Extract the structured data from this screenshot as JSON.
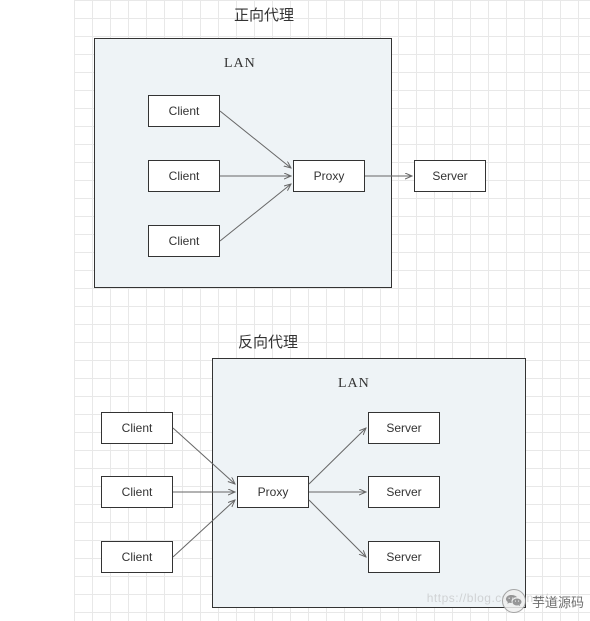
{
  "titles": {
    "forward": "正向代理",
    "reverse": "反向代理"
  },
  "lan_label": "LAN",
  "nodes": {
    "client": "Client",
    "proxy": "Proxy",
    "server": "Server"
  },
  "watermark": {
    "text": "芋道源码",
    "url": "https://blog.csdn.net/..."
  },
  "diagram": {
    "forward": {
      "lan_contains": [
        "Client",
        "Client",
        "Client",
        "Proxy"
      ],
      "outside": [
        "Server"
      ],
      "flow": "3 Clients → Proxy → Server"
    },
    "reverse": {
      "lan_contains": [
        "Proxy",
        "Server",
        "Server",
        "Server"
      ],
      "outside": [
        "Client",
        "Client",
        "Client"
      ],
      "flow": "3 Clients → Proxy → 3 Servers"
    }
  }
}
